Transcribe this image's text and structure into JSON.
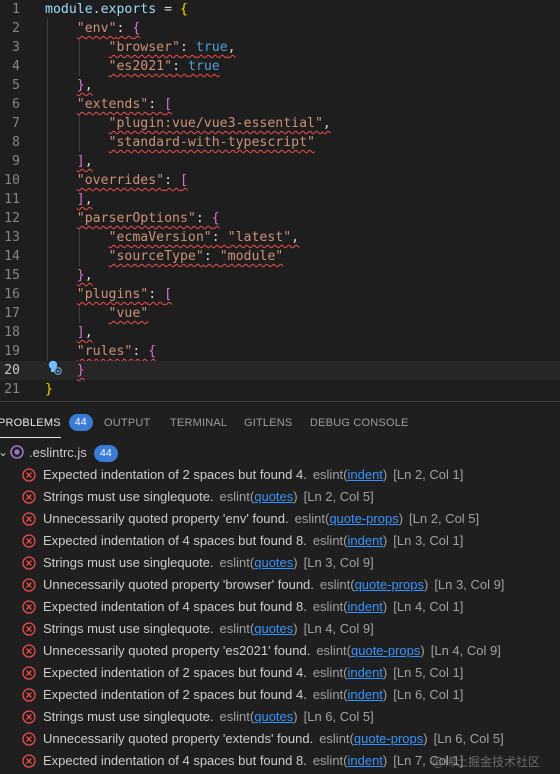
{
  "editor": {
    "lines": [
      {
        "n": "1",
        "parts": [
          [
            "k-id",
            "module"
          ],
          [
            "p-w",
            "."
          ],
          [
            "k-id",
            "exports"
          ],
          [
            "p-w",
            " = "
          ],
          [
            "b-1",
            "{"
          ]
        ],
        "sq": false
      },
      {
        "n": "2",
        "parts": [
          [
            "p-w",
            "    "
          ],
          [
            "k-str",
            "\"env\""
          ],
          [
            "p-w",
            ": "
          ],
          [
            "b-2",
            "{"
          ]
        ],
        "sq": true
      },
      {
        "n": "3",
        "parts": [
          [
            "p-w",
            "        "
          ],
          [
            "k-str",
            "\"browser\""
          ],
          [
            "p-w",
            ": "
          ],
          [
            "k-bool",
            "true"
          ],
          [
            "p-w",
            ","
          ]
        ],
        "sq": true
      },
      {
        "n": "4",
        "parts": [
          [
            "p-w",
            "        "
          ],
          [
            "k-str",
            "\"es2021\""
          ],
          [
            "p-w",
            ": "
          ],
          [
            "k-bool",
            "true"
          ]
        ],
        "sq": true
      },
      {
        "n": "5",
        "parts": [
          [
            "p-w",
            "    "
          ],
          [
            "b-2",
            "}"
          ],
          [
            "p-w",
            ","
          ]
        ],
        "sq": true
      },
      {
        "n": "6",
        "parts": [
          [
            "p-w",
            "    "
          ],
          [
            "k-str",
            "\"extends\""
          ],
          [
            "p-w",
            ": "
          ],
          [
            "b-2",
            "["
          ]
        ],
        "sq": true
      },
      {
        "n": "7",
        "parts": [
          [
            "p-w",
            "        "
          ],
          [
            "k-str",
            "\"plugin:vue/vue3-essential\""
          ],
          [
            "p-w",
            ","
          ]
        ],
        "sq": true
      },
      {
        "n": "8",
        "parts": [
          [
            "p-w",
            "        "
          ],
          [
            "k-str",
            "\"standard-with-typescript\""
          ]
        ],
        "sq": true
      },
      {
        "n": "9",
        "parts": [
          [
            "p-w",
            "    "
          ],
          [
            "b-2",
            "]"
          ],
          [
            "p-w",
            ","
          ]
        ],
        "sq": true
      },
      {
        "n": "10",
        "parts": [
          [
            "p-w",
            "    "
          ],
          [
            "k-str",
            "\"overrides\""
          ],
          [
            "p-w",
            ": "
          ],
          [
            "b-2",
            "["
          ]
        ],
        "sq": true
      },
      {
        "n": "11",
        "parts": [
          [
            "p-w",
            "    "
          ],
          [
            "b-2",
            "]"
          ],
          [
            "p-w",
            ","
          ]
        ],
        "sq": true
      },
      {
        "n": "12",
        "parts": [
          [
            "p-w",
            "    "
          ],
          [
            "k-str",
            "\"parserOptions\""
          ],
          [
            "p-w",
            ": "
          ],
          [
            "b-2",
            "{"
          ]
        ],
        "sq": true
      },
      {
        "n": "13",
        "parts": [
          [
            "p-w",
            "        "
          ],
          [
            "k-str",
            "\"ecmaVersion\""
          ],
          [
            "p-w",
            ": "
          ],
          [
            "k-str",
            "\"latest\""
          ],
          [
            "p-w",
            ","
          ]
        ],
        "sq": true
      },
      {
        "n": "14",
        "parts": [
          [
            "p-w",
            "        "
          ],
          [
            "k-str",
            "\"sourceType\""
          ],
          [
            "p-w",
            ": "
          ],
          [
            "k-str",
            "\"module\""
          ]
        ],
        "sq": true
      },
      {
        "n": "15",
        "parts": [
          [
            "p-w",
            "    "
          ],
          [
            "b-2",
            "}"
          ],
          [
            "p-w",
            ","
          ]
        ],
        "sq": true
      },
      {
        "n": "16",
        "parts": [
          [
            "p-w",
            "    "
          ],
          [
            "k-str",
            "\"plugins\""
          ],
          [
            "p-w",
            ": "
          ],
          [
            "b-2",
            "["
          ]
        ],
        "sq": true
      },
      {
        "n": "17",
        "parts": [
          [
            "p-w",
            "        "
          ],
          [
            "k-str",
            "\"vue\""
          ]
        ],
        "sq": true
      },
      {
        "n": "18",
        "parts": [
          [
            "p-w",
            "    "
          ],
          [
            "b-2",
            "]"
          ],
          [
            "p-w",
            ","
          ]
        ],
        "sq": true
      },
      {
        "n": "19",
        "parts": [
          [
            "p-w",
            "    "
          ],
          [
            "k-str",
            "\"rules\""
          ],
          [
            "p-w",
            ": "
          ],
          [
            "b-2",
            "{"
          ]
        ],
        "sq": true
      },
      {
        "n": "20",
        "parts": [
          [
            "p-w",
            "    "
          ],
          [
            "b-2",
            "}"
          ]
        ],
        "sq": true,
        "active": true
      },
      {
        "n": "21",
        "parts": [
          [
            "b-1",
            "}"
          ]
        ],
        "sq": false
      }
    ]
  },
  "panel": {
    "tabs": [
      {
        "label": "PROBLEMS",
        "badge": "44",
        "active": true
      },
      {
        "label": "OUTPUT"
      },
      {
        "label": "TERMINAL"
      },
      {
        "label": "GITLENS"
      },
      {
        "label": "DEBUG CONSOLE"
      }
    ],
    "file": {
      "name": ".eslintrc.js",
      "count": "44"
    },
    "problems": [
      {
        "msg": "Expected indentation of 2 spaces but found 4.",
        "src": "eslint",
        "rule": "indent",
        "loc": "[Ln 2, Col 1]"
      },
      {
        "msg": "Strings must use singlequote.",
        "src": "eslint",
        "rule": "quotes",
        "loc": "[Ln 2, Col 5]"
      },
      {
        "msg": "Unnecessarily quoted property 'env' found.",
        "src": "eslint",
        "rule": "quote-props",
        "loc": "[Ln 2, Col 5]"
      },
      {
        "msg": "Expected indentation of 4 spaces but found 8.",
        "src": "eslint",
        "rule": "indent",
        "loc": "[Ln 3, Col 1]"
      },
      {
        "msg": "Strings must use singlequote.",
        "src": "eslint",
        "rule": "quotes",
        "loc": "[Ln 3, Col 9]"
      },
      {
        "msg": "Unnecessarily quoted property 'browser' found.",
        "src": "eslint",
        "rule": "quote-props",
        "loc": "[Ln 3, Col 9]"
      },
      {
        "msg": "Expected indentation of 4 spaces but found 8.",
        "src": "eslint",
        "rule": "indent",
        "loc": "[Ln 4, Col 1]"
      },
      {
        "msg": "Strings must use singlequote.",
        "src": "eslint",
        "rule": "quotes",
        "loc": "[Ln 4, Col 9]"
      },
      {
        "msg": "Unnecessarily quoted property 'es2021' found.",
        "src": "eslint",
        "rule": "quote-props",
        "loc": "[Ln 4, Col 9]"
      },
      {
        "msg": "Expected indentation of 2 spaces but found 4.",
        "src": "eslint",
        "rule": "indent",
        "loc": "[Ln 5, Col 1]"
      },
      {
        "msg": "Expected indentation of 2 spaces but found 4.",
        "src": "eslint",
        "rule": "indent",
        "loc": "[Ln 6, Col 1]"
      },
      {
        "msg": "Strings must use singlequote.",
        "src": "eslint",
        "rule": "quotes",
        "loc": "[Ln 6, Col 5]"
      },
      {
        "msg": "Unnecessarily quoted property 'extends' found.",
        "src": "eslint",
        "rule": "quote-props",
        "loc": "[Ln 6, Col 5]"
      },
      {
        "msg": "Expected indentation of 4 spaces but found 8.",
        "src": "eslint",
        "rule": "indent",
        "loc": "[Ln 7, Col 1]"
      }
    ],
    "watermark": "@稀土掘金技术社区"
  },
  "colors": {
    "error": "#f14c4c",
    "badge": "#3a7bd5",
    "link": "#3794ff"
  },
  "icons": {
    "problem": "error-circle-x-icon",
    "file": "eslint-file-icon",
    "lightbulb": "quick-fix-lightbulb-icon",
    "expand": "chevron-down-icon"
  }
}
